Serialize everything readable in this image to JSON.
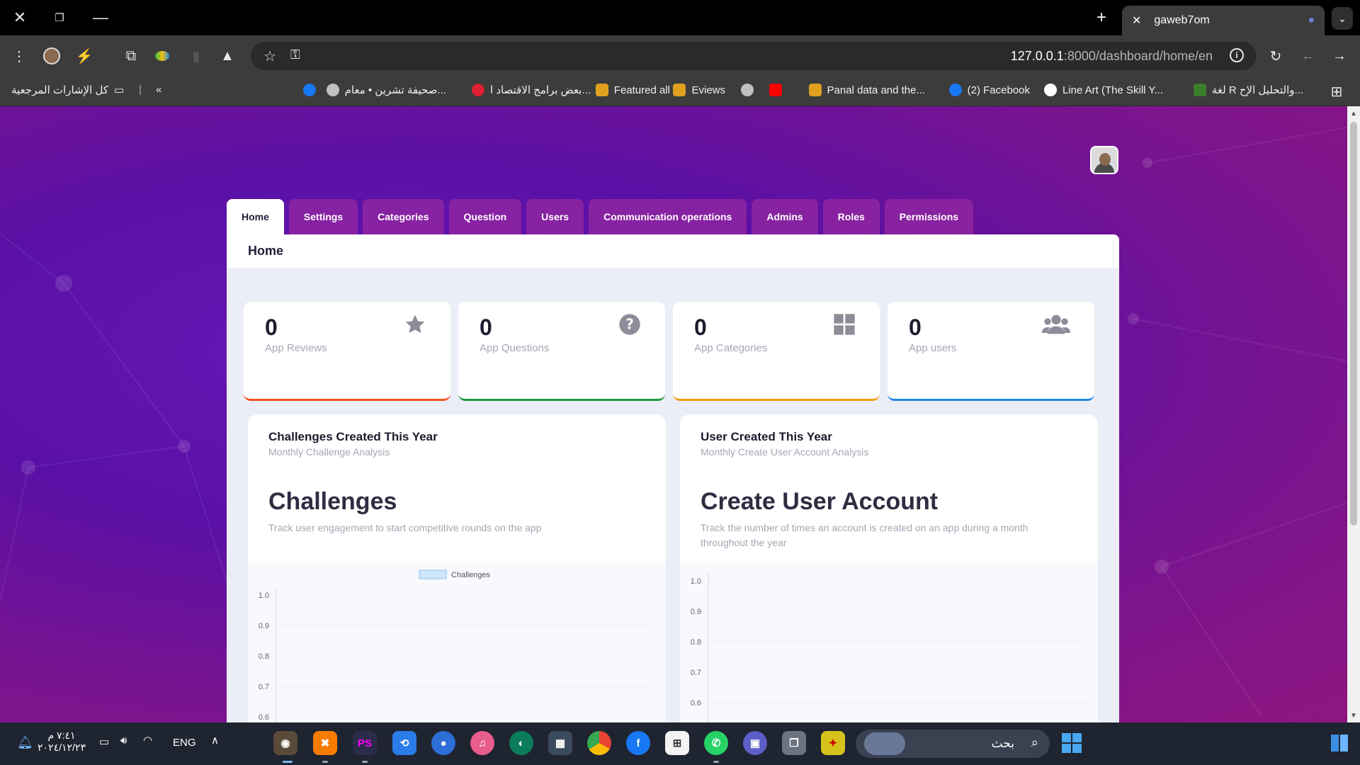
{
  "browser": {
    "tab_title": "gaweb7om",
    "url_host": "127.0.0.1",
    "url_path": ":8000/dashboard/home/en",
    "bookmarks": [
      "لغة R والتحليل الإح...",
      "Line Art (The Skill Y...",
      "(2) Facebook",
      "Panal data and the...",
      "Eviews",
      "Featured all",
      "بعض برامج الاقتصاد ا...",
      "صحيفة تشرين • معام...",
      "كل الإشارات المرجعية"
    ]
  },
  "nav": {
    "tabs": [
      "Home",
      "Settings",
      "Categories",
      "Question",
      "Users",
      "Communication operations",
      "Admins",
      "Roles",
      "Permissions"
    ],
    "active": "Home"
  },
  "panel": {
    "title": "Home"
  },
  "stats": [
    {
      "value": "0",
      "label": "App Reviews",
      "icon": "star-icon",
      "color": "#f4511e"
    },
    {
      "value": "0",
      "label": "App Questions",
      "icon": "question-circle-icon",
      "color": "#1a9c3e"
    },
    {
      "value": "0",
      "label": "App Categories",
      "icon": "grid-icon",
      "color": "#f29c11"
    },
    {
      "value": "0",
      "label": "App users",
      "icon": "users-icon",
      "color": "#1e88e5"
    }
  ],
  "cards": {
    "challenges": {
      "title": "Challenges Created This Year",
      "subtitle": "Monthly Challenge Analysis",
      "heading": "Challenges",
      "description": "Track user engagement to start competitive rounds on the app"
    },
    "users": {
      "title": "User Created This Year",
      "subtitle": "Monthly Create User Account Analysis",
      "heading": "Create User Account",
      "description": "Track the number of times an account is created on an app during a month throughout the year"
    }
  },
  "chart_data": [
    {
      "type": "bar",
      "series": [
        {
          "name": "Challenges",
          "values": []
        }
      ],
      "ytick_labels": [
        "1.0",
        "0.9",
        "0.8",
        "0.7",
        "0.6"
      ],
      "legend": "top-center",
      "grid": true
    },
    {
      "type": "bar",
      "series": [],
      "ytick_labels": [
        "1.0",
        "0.9",
        "0.8",
        "0.7",
        "0.6"
      ],
      "grid": true
    }
  ],
  "taskbar": {
    "search_placeholder": "بحث",
    "language": "ENG",
    "time": "٧:٤١ م",
    "date": "٢٠٢٤/١٢/٢٣"
  }
}
